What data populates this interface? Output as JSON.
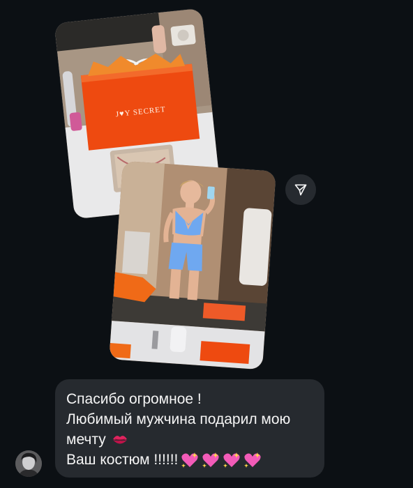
{
  "photo_1": {
    "bag_brand_text": "J♥Y SECRET"
  },
  "message": {
    "line_1": "Спасибо огромное !",
    "line_2": "Любимый мужчина подарил мою",
    "line_3": "мечту",
    "line_4": "Ваш костюм !!!!!!"
  },
  "icons": {
    "share": "send-arrow-icon",
    "lips": "kiss-mark-icon",
    "hearts": "sparkling-heart-icon"
  },
  "colors": {
    "background": "#0c1014",
    "bubble": "#262a2f",
    "text": "#f5f5f5",
    "bag_orange": "#ee4a10",
    "outfit_blue": "#6fa8f0"
  }
}
